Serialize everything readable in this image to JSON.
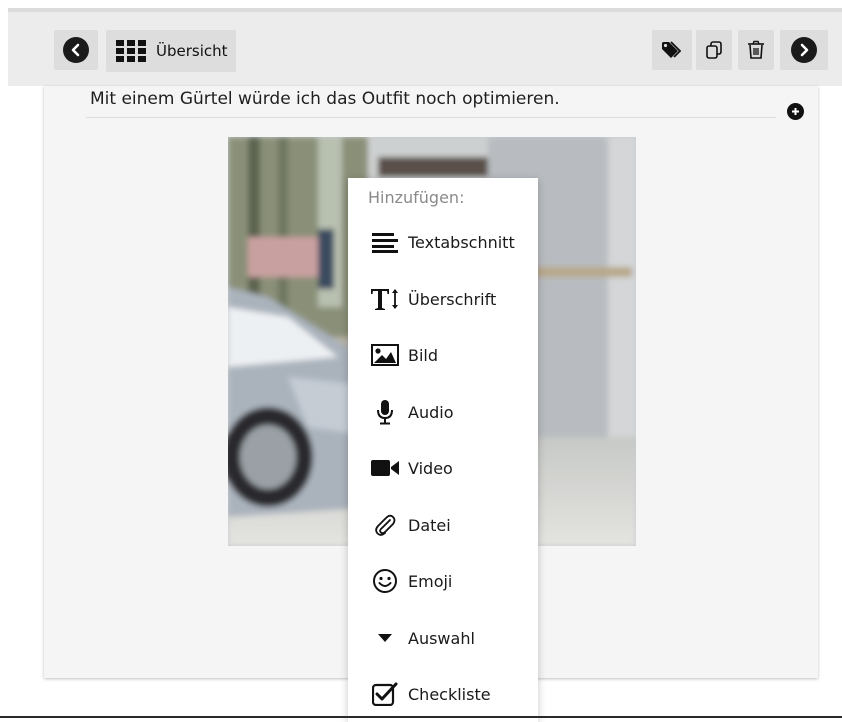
{
  "toolbar": {
    "overview_label": "Übersicht",
    "prev_icon": "chevron-left-icon",
    "next_icon": "chevron-right-icon",
    "grid_icon": "grid-icon",
    "tag_icon": "tag-icon",
    "copy_icon": "copy-icon",
    "delete_icon": "trash-icon"
  },
  "content": {
    "text_block": "Mit einem Gürtel würde ich das Outfit noch optimieren.",
    "add_icon": "plus-circle-icon"
  },
  "add_menu": {
    "title": "Hinzufügen:",
    "items": [
      {
        "label": "Textabschnitt",
        "icon": "paragraph-icon"
      },
      {
        "label": "Überschrift",
        "icon": "heading-icon"
      },
      {
        "label": "Bild",
        "icon": "image-icon"
      },
      {
        "label": "Audio",
        "icon": "microphone-icon"
      },
      {
        "label": "Video",
        "icon": "video-camera-icon"
      },
      {
        "label": "Datei",
        "icon": "paperclip-icon"
      },
      {
        "label": "Emoji",
        "icon": "smiley-icon"
      },
      {
        "label": "Auswahl",
        "icon": "dropdown-triangle-icon"
      },
      {
        "label": "Checkliste",
        "icon": "checkbox-icon"
      }
    ]
  },
  "colors": {
    "toolbar_bg": "#ececec",
    "button_bg": "#dddddd",
    "panel_bg": "#f5f5f5",
    "icon_dark": "#1a1a1a",
    "menu_title": "#8a8a8a"
  }
}
